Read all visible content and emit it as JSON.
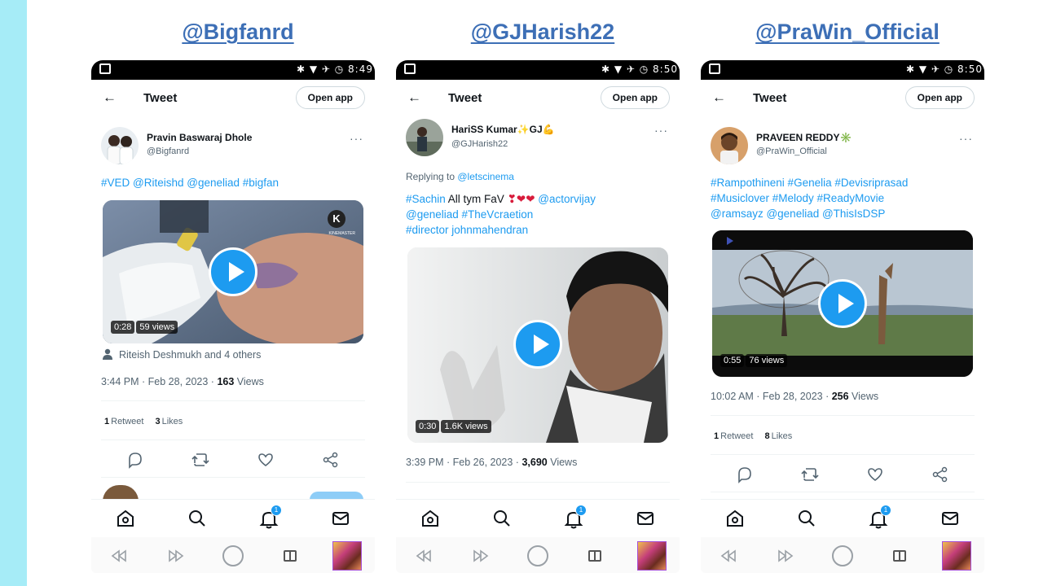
{
  "headers": [
    "@Bigfanrd",
    "@GJHarish22",
    "@PraWin_Official"
  ],
  "common": {
    "title": "Tweet",
    "open_app": "Open app",
    "more": "···",
    "notif_badge": "1"
  },
  "status_times": [
    "8:49",
    "8:50",
    "8:50"
  ],
  "phone1": {
    "author_name": "Pravin Baswaraj Dhole",
    "author_handle": "@Bigfanrd",
    "text": "#VED @Riteishd @geneliad #bigfan",
    "media_duration": "0:28",
    "media_views": "59 views",
    "media_watermark": "KINEMASTER",
    "social_context": "Riteish Deshmukh and 4 others",
    "time": "3:44 PM · Feb 28, 2023 · ",
    "views_count": "163",
    "views_label": " Views",
    "retweets_count": "1",
    "retweets_label": "Retweet",
    "likes_count": "3",
    "likes_label": "Likes"
  },
  "phone2": {
    "author_name": "HariSS Kumar✨GJ💪",
    "author_handle": "@GJHarish22",
    "replying_prefix": "Replying to ",
    "replying_handle": "@letscinema",
    "line1_tag": "#Sachin",
    "line1_plain": " All tym FaV ",
    "line1_emoji": "❣❤❤",
    "line1_mention": " @actorvijay",
    "line2": "@geneliad #TheVcraetion",
    "line3": "#director johnmahendran",
    "media_duration": "0:30",
    "media_views": "1.6K views",
    "time": "3:39 PM · Feb 26, 2023 · ",
    "views_count": "3,690",
    "views_label": " Views"
  },
  "phone3": {
    "author_name": "PRAVEEN REDDY✳️",
    "author_handle": "@PraWin_Official",
    "line1": "#Rampothineni #Genelia #Devisriprasad",
    "line2": "#Musiclover #Melody #ReadyMovie",
    "line3": "@ramsayz @geneliad @ThisIsDSP",
    "media_duration": "0:55",
    "media_views": "76 views",
    "time": "10:02 AM · Feb 28, 2023 · ",
    "views_count": "256",
    "views_label": " Views",
    "retweets_count": "1",
    "retweets_label": "Retweet",
    "likes_count": "8",
    "likes_label": "Likes"
  },
  "icons": {
    "back": "arrow-left",
    "reply": "speech-bubble",
    "retweet": "retweet-arrows",
    "like": "heart",
    "share": "share-nodes",
    "home": "home",
    "search": "magnifier",
    "notifications": "bell",
    "messages": "envelope"
  },
  "colors": {
    "accent": "#1d9bf0",
    "header_link": "#3d6fb6",
    "left_strip": "#a6ecf7"
  }
}
